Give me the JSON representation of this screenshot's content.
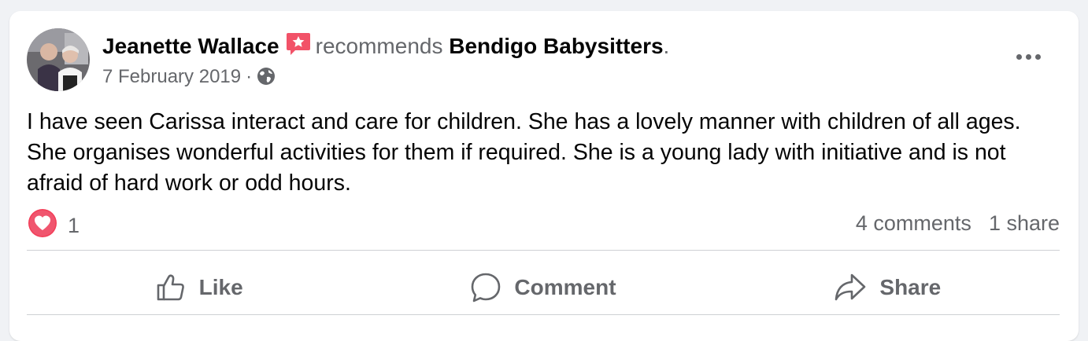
{
  "post": {
    "author": "Jeanette Wallace",
    "badge_icon": "recommendation-star-icon",
    "verb": "recommends",
    "page_name": "Bendigo Babysitters",
    "trailing_punctuation": ".",
    "date": "7 February 2019",
    "separator": "·",
    "privacy_icon": "globe-icon",
    "more_icon": "more-options-icon",
    "text": "I have seen Carissa interact and care for children. She has a lovely manner with children of all ages. She organises wonderful activities for them if required. She is a young lady with initiative and is not afraid of hard work or odd hours."
  },
  "engagement": {
    "reaction_icon": "love-reaction-icon",
    "reaction_count": "1",
    "comments": "4 comments",
    "shares": "1 share"
  },
  "actions": {
    "like_label": "Like",
    "comment_label": "Comment",
    "share_label": "Share"
  },
  "colors": {
    "text_primary": "#050505",
    "text_secondary": "#65676b",
    "divider": "#ced0d4",
    "badge": "#f25268",
    "love_reaction": "#f33e58",
    "background": "#f0f2f5"
  }
}
